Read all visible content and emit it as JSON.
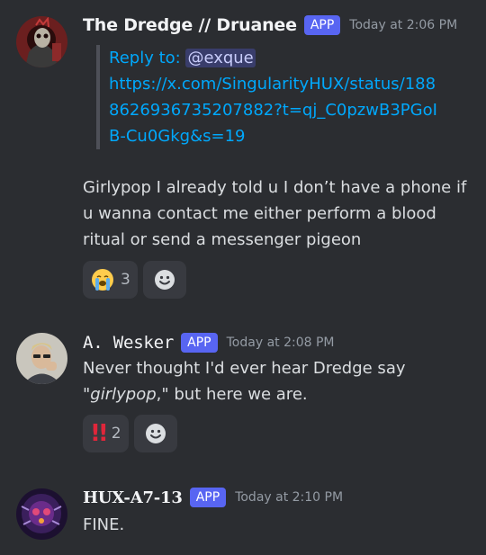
{
  "messages": [
    {
      "author": "The Dredge // Druanee",
      "badge": "APP",
      "timestamp": "Today at 2:06 PM",
      "reply_prefix": "Reply to: ",
      "reply_mention": "@exque",
      "reply_link": "https://x.com/SingularityHUX/status/1888626936735207882?t=qj_C0pzwB3PGoIB-Cu0Gkg&s=19",
      "text": "Girlypop I already told u I don’t have a phone if u wanna contact me either perform a blood ritual or send a messenger pigeon",
      "reactions": [
        {
          "emoji": "loudly-crying-face",
          "count": "3"
        }
      ],
      "add_reaction_icon": "smiley-add-icon"
    },
    {
      "author": "A. Wesker",
      "badge": "APP",
      "timestamp": "Today at 2:08 PM",
      "text_before": "Never thought I'd ever hear Dredge say \"",
      "text_italic": "girlypop",
      "text_after": ",\" but here we are.",
      "reactions": [
        {
          "emoji": "double-exclamation-mark",
          "count": "2"
        }
      ],
      "add_reaction_icon": "smiley-add-icon"
    },
    {
      "author": "HUX-A7-13",
      "badge": "APP",
      "timestamp": "Today at 2:10 PM",
      "text": "FINE."
    }
  ],
  "colors": {
    "background": "#2b2d31",
    "badge": "#5865f2",
    "link": "#00a8fc",
    "reaction_bg": "#383a40"
  }
}
